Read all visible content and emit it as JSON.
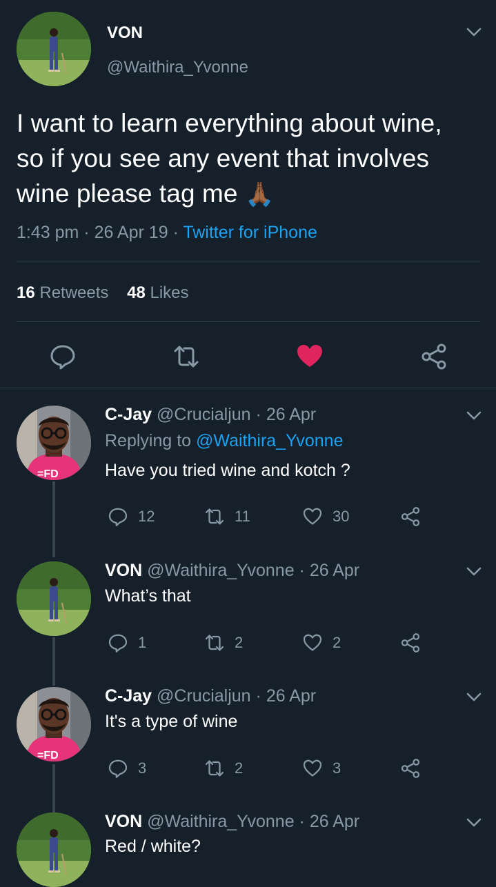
{
  "colors": {
    "background": "#15202b",
    "muted": "#8899a6",
    "link": "#1da1f2",
    "like": "#e0245e",
    "divider": "#38444d"
  },
  "main_tweet": {
    "name": "VON",
    "handle": "@Waithira_Yvonne",
    "text_line1": "I want to learn everything about wine,",
    "text_line2": "so if you see any event that involves",
    "text_line3": "wine please tag me",
    "emoji": "🙏🏾",
    "time": "1:43 pm",
    "date": "26 Apr 19",
    "source": "Twitter for iPhone",
    "retweets_count": "16",
    "retweets_label": "Retweets",
    "likes_count": "48",
    "likes_label": "Likes",
    "liked": true
  },
  "replies": [
    {
      "name": "C-Jay",
      "handle": "@Crucialjun",
      "date": "· 26 Apr",
      "replying_prefix": "Replying to",
      "replying_to": "@Waithira_Yvonne",
      "text": "Have you tried wine and kotch ?",
      "replies": "12",
      "retweets": "11",
      "likes": "30"
    },
    {
      "name": "VON",
      "handle": "@Waithira_Yvonne",
      "date": "· 26 Apr",
      "text": "What’s that",
      "replies": "1",
      "retweets": "2",
      "likes": "2"
    },
    {
      "name": "C-Jay",
      "handle": "@Crucialjun",
      "date": "· 26 Apr",
      "text": "It's a type of wine",
      "replies": "3",
      "retweets": "2",
      "likes": "3"
    },
    {
      "name": "VON",
      "handle": "@Waithira_Yvonne",
      "date": "· 26 Apr",
      "text": "Red / white?"
    }
  ],
  "icons": [
    "chevron-down-icon",
    "reply-icon",
    "retweet-icon",
    "like-icon",
    "share-icon"
  ]
}
